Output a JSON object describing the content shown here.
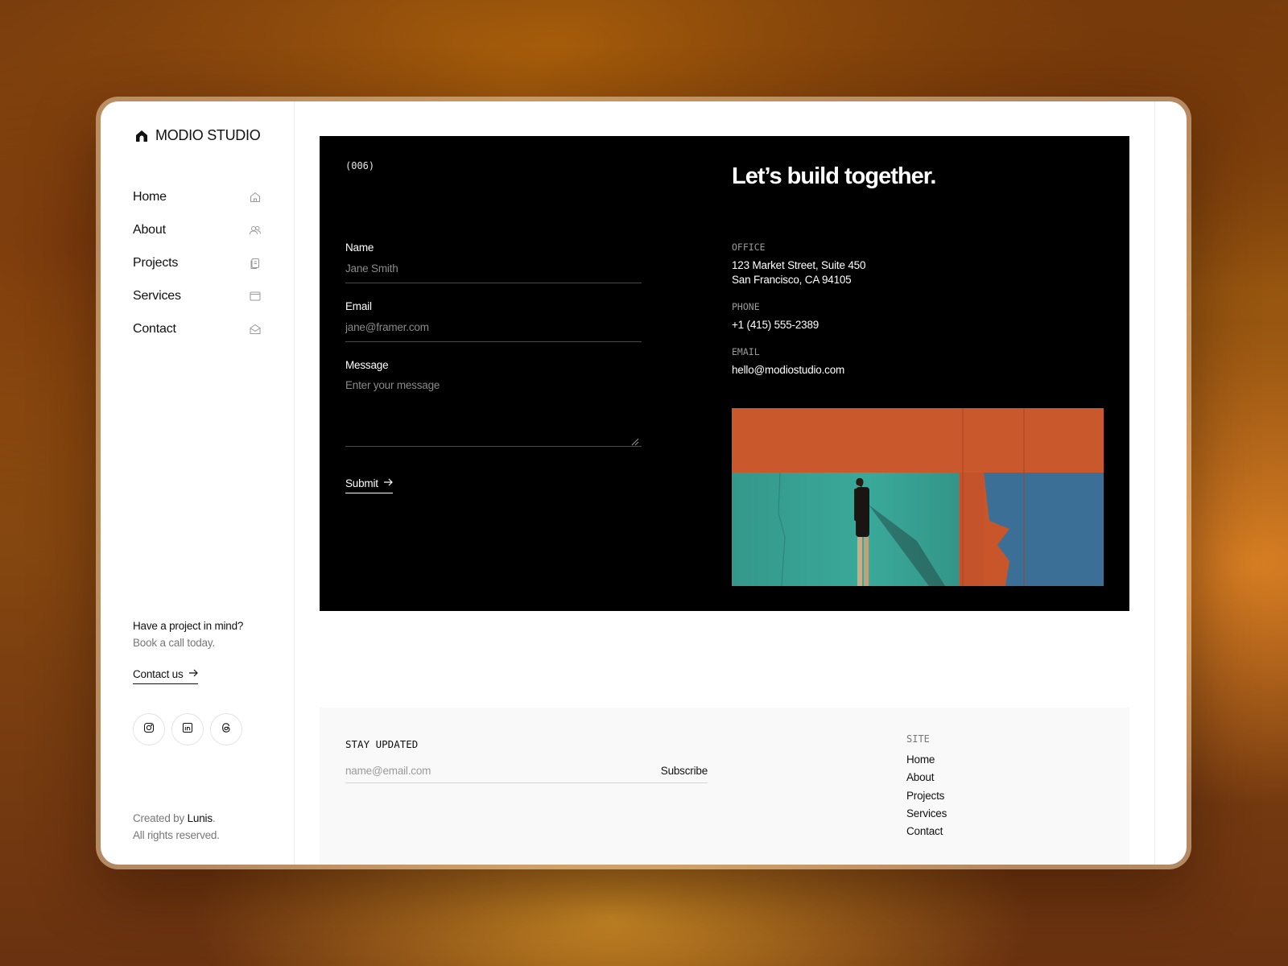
{
  "brand": {
    "name": "MODIO STUDIO",
    "logo_icon": "house-arch-icon"
  },
  "nav": {
    "items": [
      {
        "label": "Home",
        "icon": "home-icon"
      },
      {
        "label": "About",
        "icon": "users-icon"
      },
      {
        "label": "Projects",
        "icon": "files-icon"
      },
      {
        "label": "Services",
        "icon": "browser-window-icon"
      },
      {
        "label": "Contact",
        "icon": "mail-open-icon"
      }
    ]
  },
  "promo": {
    "title": "Have a project in mind?",
    "subtitle": "Book a call today.",
    "cta_label": "Contact us"
  },
  "socials": [
    {
      "icon": "instagram-icon"
    },
    {
      "icon": "linkedin-icon"
    },
    {
      "icon": "threads-icon"
    }
  ],
  "credits": {
    "created_by": "Created by",
    "author": "Lunis",
    "period": ".",
    "rights": "All rights reserved."
  },
  "hero": {
    "section_number": "(006)",
    "title": "Let’s build together.",
    "form": {
      "name_label": "Name",
      "name_placeholder": "Jane Smith",
      "email_label": "Email",
      "email_placeholder": "jane@framer.com",
      "message_label": "Message",
      "message_placeholder": "Enter your message",
      "submit_label": "Submit"
    },
    "office_label": "OFFICE",
    "office_line1": "123 Market Street, Suite 450",
    "office_line2": "San Francisco, CA 94105",
    "phone_label": "PHONE",
    "phone": "+1 (415) 555-2389",
    "email_label": "EMAIL",
    "email": "hello@modiostudio.com"
  },
  "footer": {
    "stay_updated_label": "STAY UPDATED",
    "subscribe_placeholder": "name@email.com",
    "subscribe_label": "Subscribe",
    "site_label": "SITE",
    "site_links": [
      "Home",
      "About",
      "Projects",
      "Services",
      "Contact"
    ]
  },
  "colors": {
    "hero_bg": "#000000",
    "wall_orange": "#c8562a",
    "wall_teal": "#3aa99a",
    "wall_blue": "#3b6f96"
  }
}
